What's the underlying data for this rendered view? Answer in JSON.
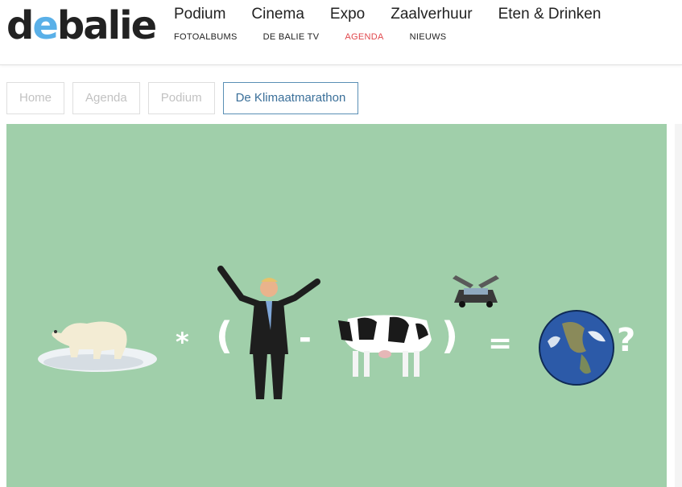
{
  "logo": {
    "part1": "d",
    "part2": "e",
    "part3": "balie",
    "accent": "#5ab0e8"
  },
  "nav": {
    "main": [
      "Podium",
      "Cinema",
      "Expo",
      "Zaalverhuur",
      "Eten & Drinken"
    ],
    "sub": [
      "FOTOALBUMS",
      "DE BALIE TV",
      "AGENDA",
      "NIEUWS"
    ],
    "active_sub": "AGENDA",
    "active_color": "#e0474c"
  },
  "breadcrumb": {
    "items": [
      "Home",
      "Agenda",
      "Podium",
      "De Klimaatmarathon"
    ]
  },
  "banner": {
    "background": "#a0cfaa",
    "equation": {
      "times": "*",
      "open": "(",
      "minus": "-",
      "close": ")",
      "equals": "=",
      "question": "?"
    },
    "images": [
      "polar-bear-on-ice",
      "man-in-suit-arms-raised",
      "holstein-cow",
      "electric-car-gullwing",
      "planet-earth"
    ]
  }
}
